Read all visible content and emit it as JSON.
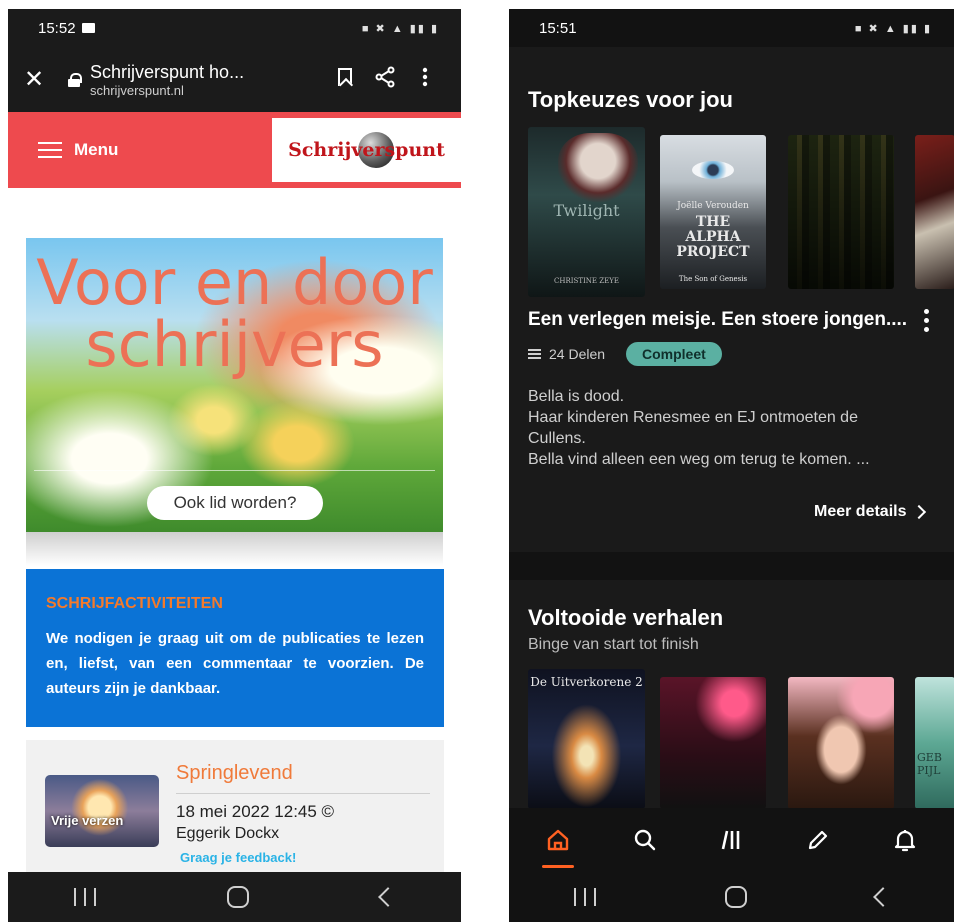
{
  "left_phone": {
    "status_time": "15:52",
    "browser": {
      "page_title": "Schrijverspunt ho...",
      "domain": "schrijverspunt.nl"
    },
    "site": {
      "menu_label": "Menu",
      "logo_text": "Schrijverspunt",
      "hero_title": "Voor en door schrijvers",
      "hero_button": "Ook lid worden?",
      "activities": {
        "title": "SCHRIJFACTIVITEITEN",
        "text": "We nodigen je graag uit om de publicaties te lezen en, liefst, van een commentaar te voorzien. De auteurs zijn je dankbaar."
      },
      "post": {
        "thumb_label": "Vrije verzen",
        "title": "Springlevend",
        "date": "18 mei 2022 12:45 ©",
        "author": "Eggerik Dockx",
        "feedback": "Graag je feedback!"
      }
    }
  },
  "right_phone": {
    "status_time": "15:51",
    "top_picks": {
      "title": "Topkeuzes voor jou",
      "covers": [
        {
          "text": "Twilight",
          "subtext": "CHRISTINE ZEYE"
        },
        {
          "author": "Joëlle Verouden",
          "text": "THE ALPHA PROJECT",
          "subtext": "The Son of Genesis"
        },
        {
          "text": ""
        },
        {
          "text": ""
        }
      ],
      "story_title": "Een verlegen meisje. Een stoere jongen....",
      "parts": "24 Delen",
      "badge": "Compleet",
      "description": [
        "Bella is dood.",
        "Haar kinderen Renesmee en EJ ontmoeten de",
        "Cullens.",
        "Bella vind alleen een weg om terug te komen. ..."
      ],
      "more_details": "Meer details"
    },
    "completed": {
      "title": "Voltooide verhalen",
      "subtitle": "Binge van start tot finish",
      "covers": [
        {
          "text": "De Uitverkorene 2"
        },
        {
          "text": ""
        },
        {
          "text": ""
        },
        {
          "text": "GEB PIJL"
        }
      ]
    },
    "colors": {
      "accent": "#ff6122",
      "badge": "#5bb0a2",
      "site_red": "#ee4a4e",
      "activities_blue": "#0b73d6"
    },
    "tabs": [
      "home-icon",
      "search-icon",
      "library-icon",
      "write-icon",
      "notifications-icon"
    ]
  }
}
